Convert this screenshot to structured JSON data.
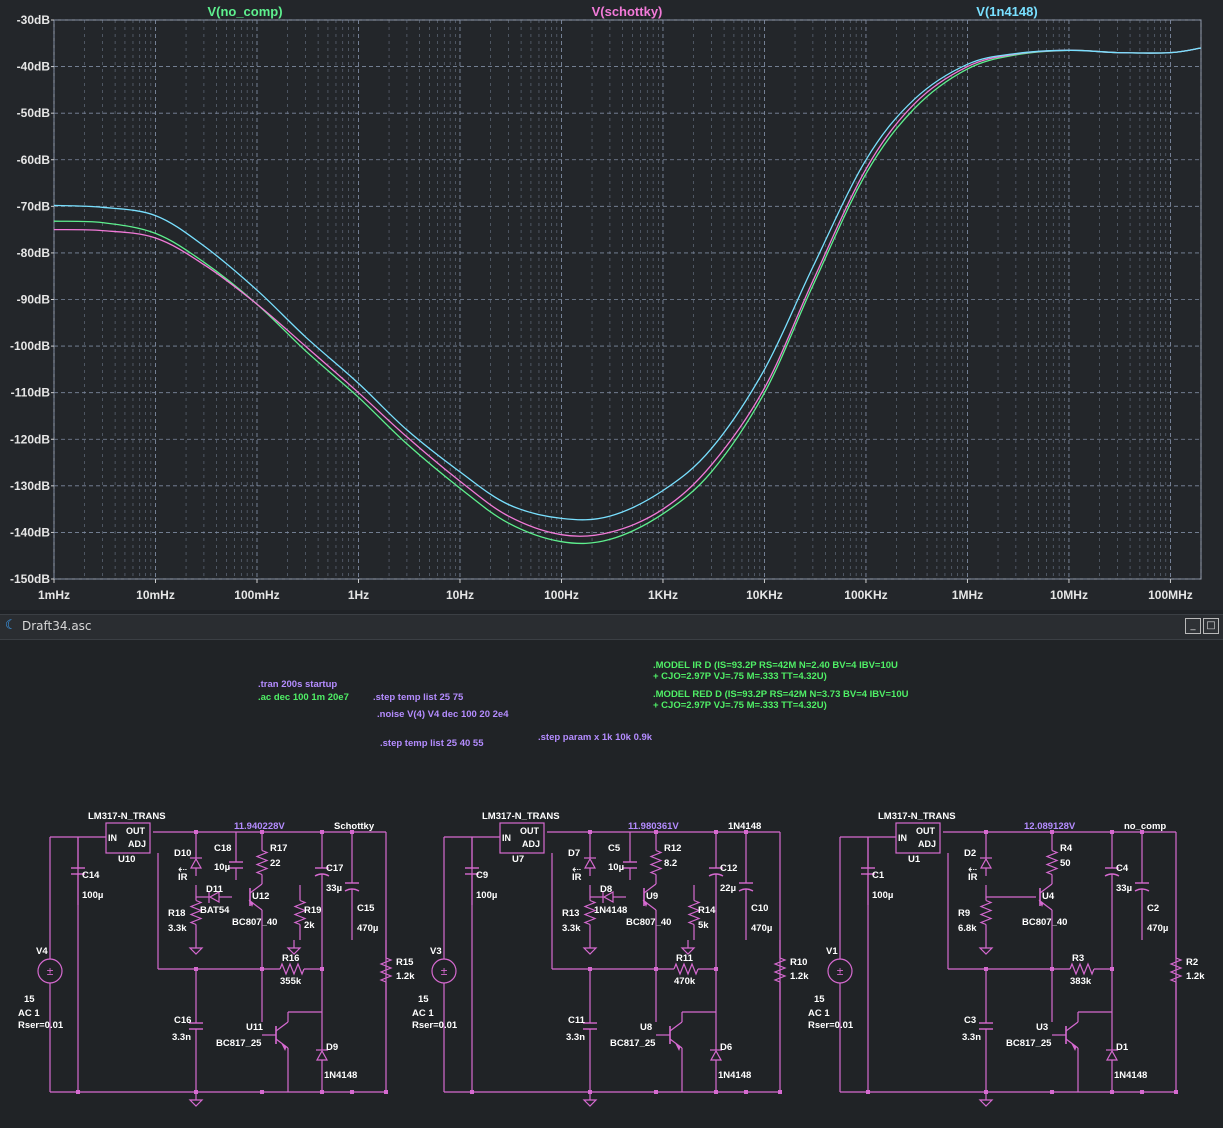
{
  "window": {
    "title": "Draft34.asc",
    "min_btn": "_",
    "close_btn": "□"
  },
  "colors": {
    "no_comp": "#5ef08e",
    "schottky": "#f27ad8",
    "n4148": "#79e0ff",
    "grid": "#7e8aa0",
    "wire": "#d66ad0",
    "spice_green": "#4fef66",
    "spice_violet": "#b48cff",
    "netlabel": "#b48cff"
  },
  "chart_data": {
    "type": "line",
    "title": "",
    "xlabel": "",
    "ylabel": "",
    "xscale": "log",
    "xlim": [
      0.001,
      200000000
    ],
    "ylim": [
      -150,
      -30
    ],
    "grid": true,
    "legend": "top",
    "y_ticks": [
      "-30dB",
      "-40dB",
      "-50dB",
      "-60dB",
      "-70dB",
      "-80dB",
      "-90dB",
      "-100dB",
      "-110dB",
      "-120dB",
      "-130dB",
      "-140dB",
      "-150dB"
    ],
    "y_tick_values": [
      -30,
      -40,
      -50,
      -60,
      -70,
      -80,
      -90,
      -100,
      -110,
      -120,
      -130,
      -140,
      -150
    ],
    "x_ticks": [
      "1mHz",
      "10mHz",
      "100mHz",
      "1Hz",
      "10Hz",
      "100Hz",
      "1KHz",
      "10KHz",
      "100KHz",
      "1MHz",
      "10MHz",
      "100MHz"
    ],
    "x_tick_values": [
      0.001,
      0.01,
      0.1,
      1,
      10,
      100,
      1000,
      10000,
      100000,
      1000000,
      10000000,
      100000000
    ],
    "x": [
      0.001,
      0.003,
      0.01,
      0.03,
      0.1,
      0.3,
      1,
      3,
      10,
      30,
      100,
      300,
      1000,
      3000,
      10000,
      30000,
      100000,
      300000,
      1000000,
      3000000,
      10000000,
      30000000,
      100000000,
      200000000
    ],
    "series": [
      {
        "name": "V(no_comp)",
        "values": [
          -73.2,
          -73.5,
          -75.8,
          -82,
          -91,
          -101,
          -111,
          -121,
          -130.5,
          -138,
          -142,
          -141.5,
          -136,
          -127,
          -110,
          -87,
          -63,
          -49,
          -40.5,
          -37.5,
          -36.5,
          -37,
          -37,
          -36
        ]
      },
      {
        "name": "V(schottky)",
        "values": [
          -75,
          -75.2,
          -76.8,
          -82.5,
          -91,
          -100,
          -110,
          -119.5,
          -129,
          -136.5,
          -140.5,
          -140,
          -135,
          -125.5,
          -109,
          -86,
          -62,
          -48,
          -40,
          -37.3,
          -36.5,
          -37,
          -37,
          -36
        ]
      },
      {
        "name": "V(1n4148)",
        "values": [
          -69.8,
          -70.2,
          -72,
          -78.5,
          -88,
          -98,
          -108,
          -118,
          -127,
          -134,
          -137,
          -136.5,
          -131,
          -122,
          -105,
          -83,
          -60,
          -47,
          -39.5,
          -37.2,
          -36.5,
          -37,
          -37,
          -36
        ]
      }
    ]
  },
  "schematic": {
    "directives": {
      "tran": ".tran 200s startup",
      "ac": ".ac dec 100 1m 20e7",
      "step_temp1": ".step temp list 25 75",
      "noise": ".noise V(4) V4 dec 100 20 2e4",
      "step_temp2": ".step temp list 25 40 55",
      "step_param": ".step param x 1k 10k 0.9k",
      "model_ir_1": ".MODEL IR D (IS=93.2P RS=42M N=2.40 BV=4 IBV=10U",
      "model_ir_2": "+ CJO=2.97P VJ=.75 M=.333 TT=4.32U)",
      "model_red_1": ".MODEL RED D (IS=93.2P RS=42M N=3.73 BV=4 IBV=10U",
      "model_red_2": "+ CJO=2.97P VJ=.75 M=.333 TT=4.32U)"
    },
    "circuits": [
      {
        "reg": "LM317-N_TRANS",
        "reg_ref": "U10",
        "in": "IN",
        "out": "OUT",
        "adj": "ADJ",
        "vout": "11.940228V",
        "net": "Schottky",
        "c_in": "C14",
        "c_in_v": "100µ",
        "d_led": "D10",
        "d_led_v": "IR",
        "d_comp": "D11",
        "d_comp_v": "BAT54",
        "c_a": "C18",
        "c_a_v": "10µ",
        "r_a": "R17",
        "r_a_v": "22",
        "q_top": "U12",
        "q_top_v": "BC807_40",
        "r_b": "R18",
        "r_b_v": "3.3k",
        "r_c": "R19",
        "r_c_v": "2k",
        "c_b": "C17",
        "c_b_v": "33µ",
        "c_out": "C15",
        "c_out_v": "470µ",
        "r_fb": "R16",
        "r_fb_v": "355k",
        "r_load": "R15",
        "r_load_v": "1.2k",
        "c_c": "C16",
        "c_c_v": "3.3n",
        "q_bot": "U11",
        "q_bot_v": "BC817_25",
        "d_out": "D9",
        "d_out_v": "1N4148",
        "src": "V4",
        "src_dc": "15",
        "src_ac": "AC 1",
        "src_rser": "Rser=0.01"
      },
      {
        "reg": "LM317-N_TRANS",
        "reg_ref": "U7",
        "in": "IN",
        "out": "OUT",
        "adj": "ADJ",
        "vout": "11.980361V",
        "net": "1N4148",
        "c_in": "C9",
        "c_in_v": "100µ",
        "d_led": "D7",
        "d_led_v": "IR",
        "d_comp": "D8",
        "d_comp_v": "1N4148",
        "c_a": "C5",
        "c_a_v": "10µ",
        "r_a": "R12",
        "r_a_v": "8.2",
        "q_top": "U9",
        "q_top_v": "BC807_40",
        "r_b": "R13",
        "r_b_v": "3.3k",
        "r_c": "R14",
        "r_c_v": "5k",
        "c_b": "C12",
        "c_b_v": "22µ",
        "c_out": "C10",
        "c_out_v": "470µ",
        "r_fb": "R11",
        "r_fb_v": "470k",
        "r_load": "R10",
        "r_load_v": "1.2k",
        "c_c": "C11",
        "c_c_v": "3.3n",
        "q_bot": "U8",
        "q_bot_v": "BC817_25",
        "d_out": "D6",
        "d_out_v": "1N4148",
        "src": "V3",
        "src_dc": "15",
        "src_ac": "AC 1",
        "src_rser": "Rser=0.01"
      },
      {
        "reg": "LM317-N_TRANS",
        "reg_ref": "U1",
        "in": "IN",
        "out": "OUT",
        "adj": "ADJ",
        "vout": "12.089128V",
        "net": "no_comp",
        "c_in": "C1",
        "c_in_v": "100µ",
        "d_led": "D2",
        "d_led_v": "IR",
        "r_a": "R4",
        "r_a_v": "50",
        "q_top": "U4",
        "q_top_v": "BC807_40",
        "r_b": "R9",
        "r_b_v": "6.8k",
        "c_b": "C4",
        "c_b_v": "33µ",
        "c_out": "C2",
        "c_out_v": "470µ",
        "r_fb": "R3",
        "r_fb_v": "383k",
        "r_load": "R2",
        "r_load_v": "1.2k",
        "c_c": "C3",
        "c_c_v": "3.3n",
        "q_bot": "U3",
        "q_bot_v": "BC817_25",
        "d_out": "D1",
        "d_out_v": "1N4148",
        "src": "V1",
        "src_dc": "15",
        "src_ac": "AC 1",
        "src_rser": "Rser=0.01"
      }
    ]
  }
}
